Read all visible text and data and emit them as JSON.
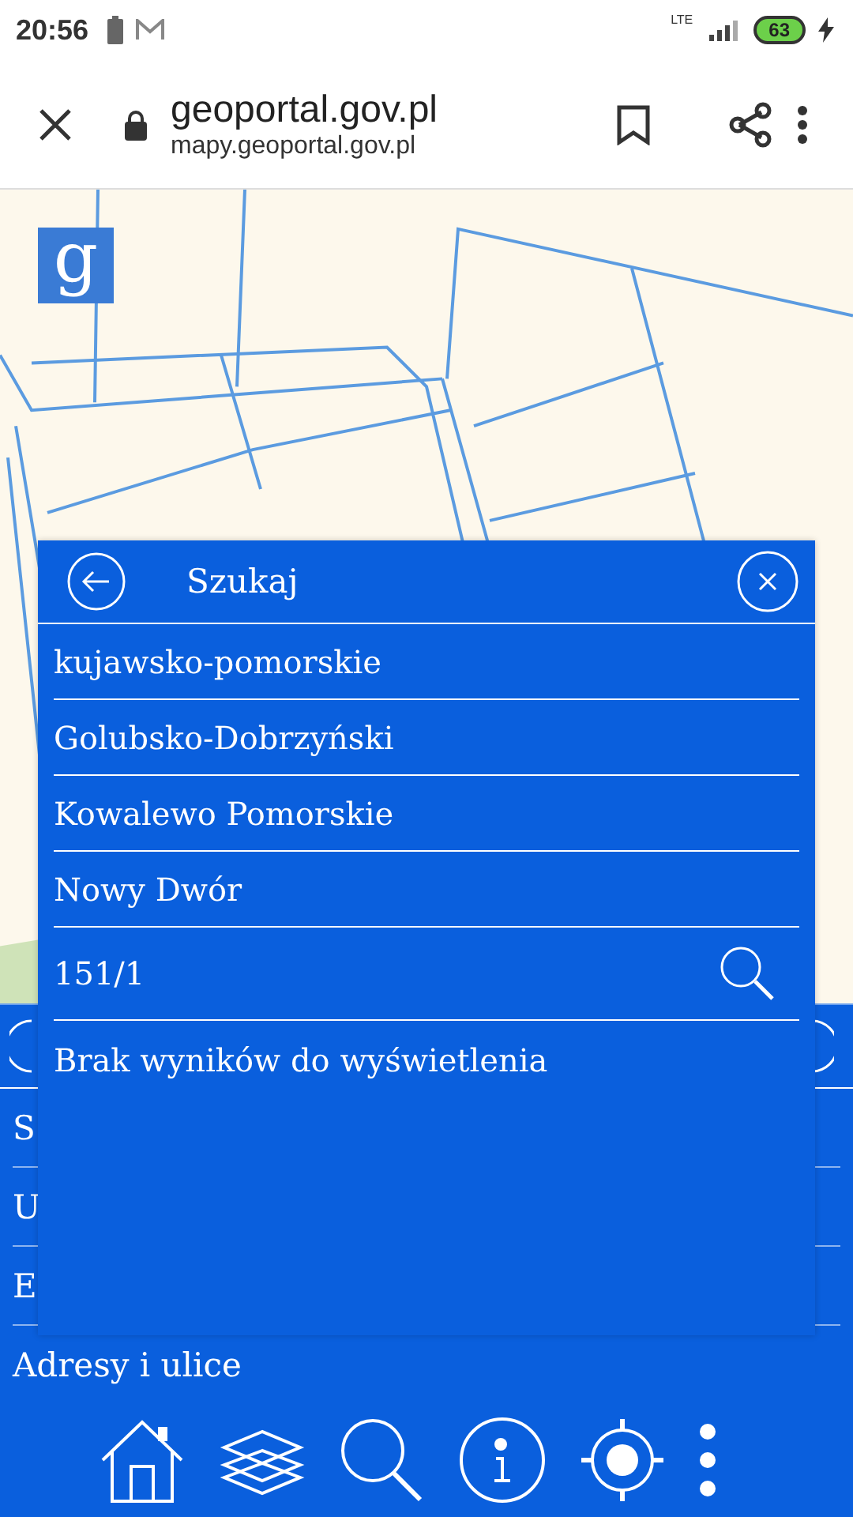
{
  "status_bar": {
    "time": "20:56",
    "network": "LTE",
    "battery": "63"
  },
  "browser": {
    "title": "geoportal.gov.pl",
    "url": "mapy.geoportal.gov.pl"
  },
  "map": {
    "kind": "picture",
    "logo": "g"
  },
  "back_panel": {
    "items": [
      "S",
      "U",
      "E",
      "Adresy i ulice"
    ]
  },
  "search_panel": {
    "title": "Szukaj",
    "fields": [
      "kujawsko-pomorskie",
      "Golubsko-Dobrzyński",
      "Kowalewo Pomorskie",
      "Nowy Dwór"
    ],
    "query": "151/1",
    "message": "Brak wyników do wyświetlenia"
  }
}
